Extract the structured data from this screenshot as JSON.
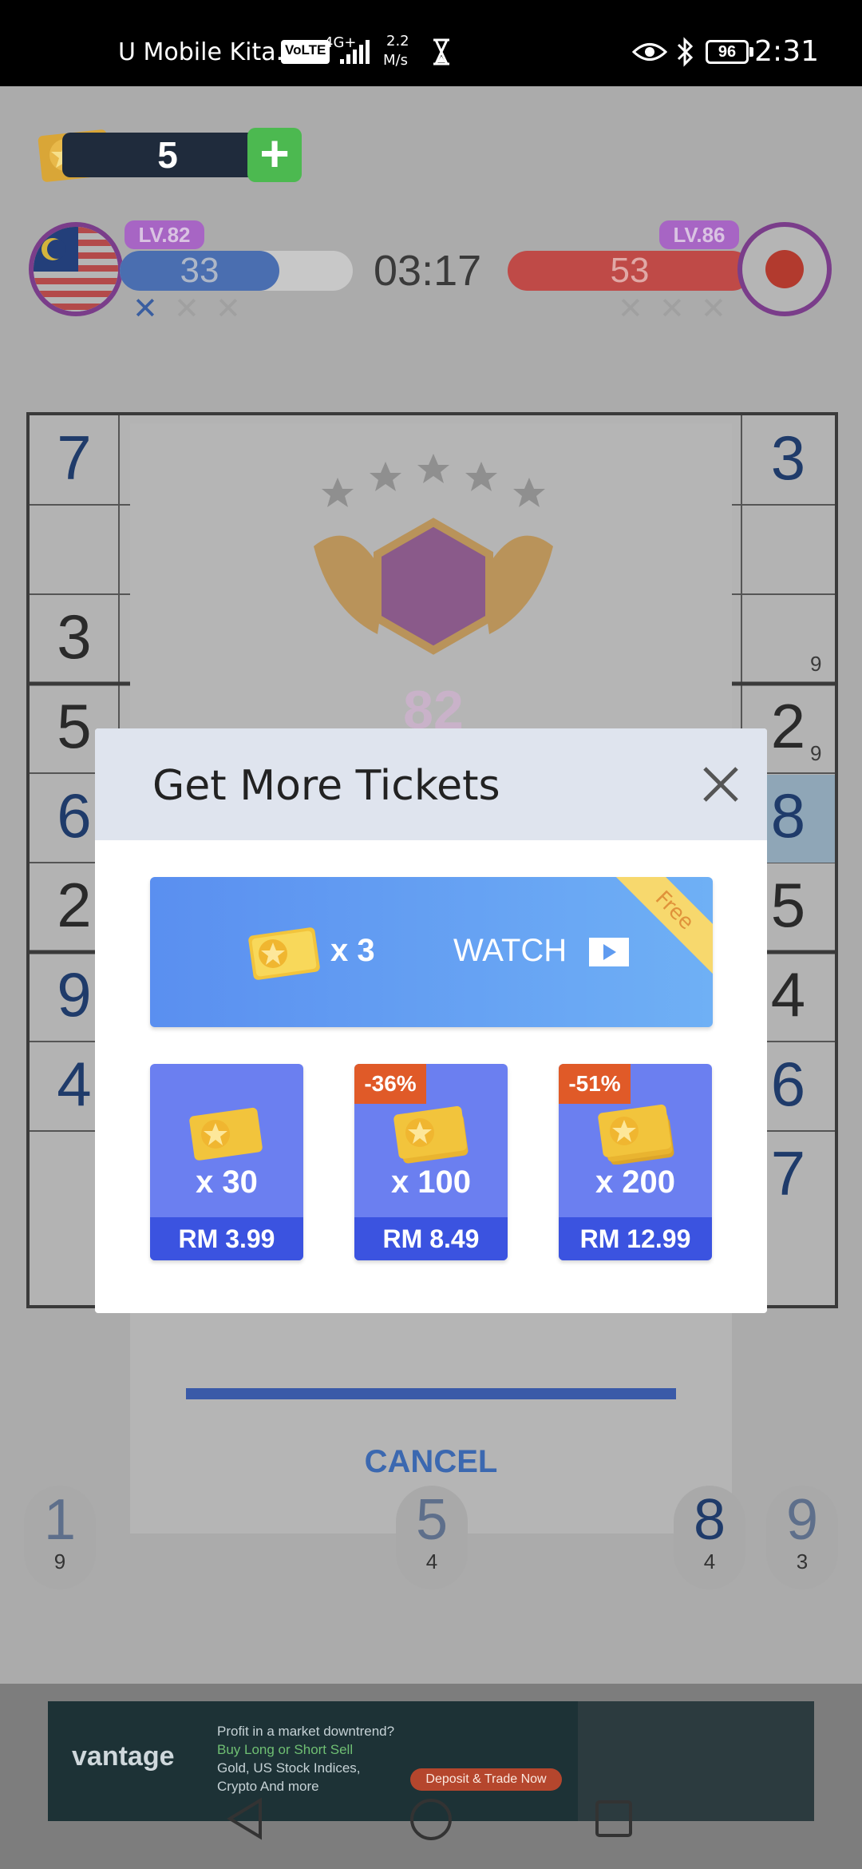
{
  "status_bar": {
    "carrier": "U Mobile Kita...",
    "volte": "VoLTE",
    "network": "4G+",
    "speed_value": "2.2",
    "speed_unit": "M/s",
    "battery": "96",
    "time": "2:31"
  },
  "game": {
    "tickets": "5",
    "timer": "03:17",
    "player": {
      "level": "LV.82",
      "score": "33"
    },
    "opponent": {
      "level": "LV.86",
      "score": "53"
    },
    "level_badge": "82",
    "cancel_label": "CANCEL",
    "board_left": [
      "7",
      "",
      "3",
      "5",
      "6",
      "2",
      "9",
      "4",
      ""
    ],
    "board_right": [
      "3",
      "",
      "",
      "2",
      "8",
      "5",
      "4",
      "6",
      "7"
    ],
    "notes_right": [
      "9",
      "9"
    ],
    "numpad": [
      {
        "digit": "1",
        "count": "9"
      },
      {
        "digit": "5",
        "count": "4"
      },
      {
        "digit": "8",
        "count": "4"
      },
      {
        "digit": "9",
        "count": "3"
      }
    ]
  },
  "modal": {
    "title": "Get More Tickets",
    "watch": {
      "quantity": "x 3",
      "label": "WATCH",
      "ribbon": "Free"
    },
    "packs": [
      {
        "quantity": "x 30",
        "price": "RM 3.99",
        "discount": ""
      },
      {
        "quantity": "x 100",
        "price": "RM 8.49",
        "discount": "-36%"
      },
      {
        "quantity": "x 200",
        "price": "RM 12.99",
        "discount": "-51%"
      }
    ]
  },
  "ad": {
    "brand": "vantage",
    "line1": "Profit in a market downtrend?",
    "line2": "Buy Long or Short Sell",
    "line3": "Gold, US Stock Indices,",
    "line4": "Crypto And more",
    "cta": "Deposit & Trade Now"
  },
  "colors": {
    "accent_blue": "#3b53e0",
    "pack_blue": "#6b7ff0",
    "discount_orange": "#e05a28",
    "add_green": "#4cb950"
  }
}
